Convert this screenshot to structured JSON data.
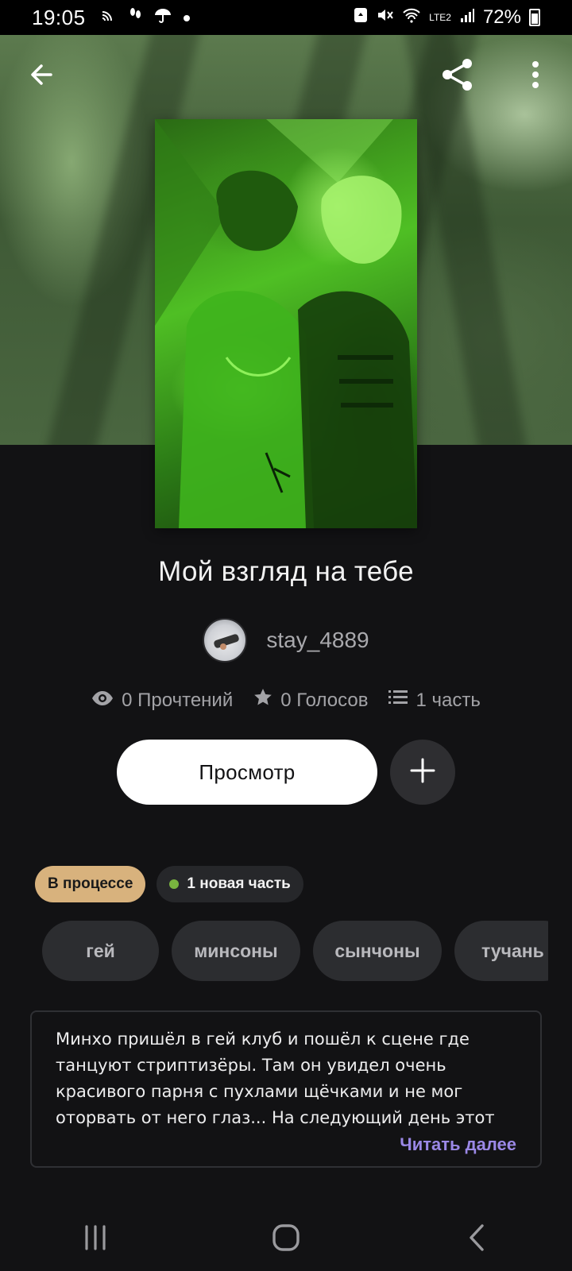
{
  "status_bar": {
    "time": "19:05",
    "battery": "72%",
    "network": "LTE2"
  },
  "header": {
    "back_icon": "arrow-left-icon",
    "share_icon": "share-icon",
    "more_icon": "more-vert-icon"
  },
  "story": {
    "title": "Мой взгляд на тебе",
    "author": "stay_4889",
    "stats": {
      "reads": "0 Прочтений",
      "votes": "0 Голосов",
      "parts": "1 часть"
    },
    "view_label": "Просмотр",
    "status_badge": "В процессе",
    "new_parts_badge": "1 новая часть",
    "tags": [
      "гей",
      "минсоны",
      "сынчоны",
      "тучань"
    ],
    "description": "Минхо пришёл в гей клуб и пошёл к сцене где танцуют стриптизёры. Там он увидел очень красивого парня с пухлами щёчками и не мог оторвать от него глаз... На следующий день этот",
    "read_more": "Читать далее"
  },
  "colors": {
    "background": "#121214",
    "status_badge": "#d8b27d",
    "new_dot": "#79b43f",
    "read_more": "#9b88e6"
  }
}
